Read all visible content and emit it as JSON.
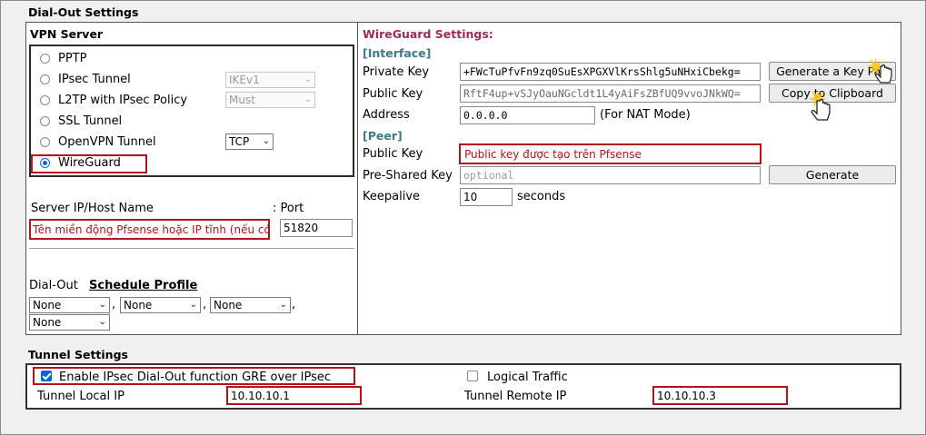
{
  "section_title": "Dial-Out Settings",
  "vpn_server": {
    "title": "VPN Server",
    "options": [
      {
        "label": "PPTP",
        "selected": false
      },
      {
        "label": "IPsec Tunnel",
        "selected": false
      },
      {
        "label": "L2TP with IPsec Policy",
        "selected": false
      },
      {
        "label": "SSL Tunnel",
        "selected": false
      },
      {
        "label": "OpenVPN Tunnel",
        "selected": false
      },
      {
        "label": "WireGuard",
        "selected": true
      }
    ],
    "ipsec_select": "IKEv1",
    "l2tp_select": "Must",
    "openvpn_select": "TCP"
  },
  "server": {
    "host_label": "Server IP/Host Name",
    "port_label": ": Port",
    "host_value": "Tên miền động Pfsense hoặc IP tĩnh (nếu có)",
    "port_value": "51820"
  },
  "dial_out": {
    "label": "Dial-Out",
    "schedule_label": "Schedule Profile",
    "profiles": [
      "None",
      "None",
      "None",
      "None"
    ],
    "separator": ","
  },
  "wireguard": {
    "title": "WireGuard Settings:",
    "interface_label": "[Interface]",
    "private_key_label": "Private Key",
    "private_key_value": "+FWcTuPfvFn9zq0SuEsXPGXVlKrsShlg5uNHxiCbekg=",
    "public_key_label": "Public Key",
    "public_key_value": "RftF4up+vSJyOauNGcldt1L4yAiFsZBfUQ9vvoJNkWQ=",
    "address_label": "Address",
    "address_value": "0.0.0.0",
    "address_note": "(For NAT Mode)",
    "generate_keypair_button": "Generate a Key Pair",
    "copy_button": "Copy to Clipboard",
    "peer_label": "[Peer]",
    "peer_public_key_label": "Public Key",
    "peer_public_key_value": "Public key được tạo trên Pfsense",
    "psk_label": "Pre-Shared Key",
    "psk_placeholder": "optional",
    "generate_button": "Generate",
    "keepalive_label": "Keepalive",
    "keepalive_value": "10",
    "keepalive_unit": "seconds"
  },
  "tunnel": {
    "title": "Tunnel Settings",
    "gre_label": "Enable IPsec Dial-Out function GRE over IPsec",
    "gre_checked": true,
    "logical_label": "Logical Traffic",
    "logical_checked": false,
    "local_ip_label": "Tunnel Local IP",
    "local_ip_value": "10.10.10.1",
    "remote_ip_label": "Tunnel Remote IP",
    "remote_ip_value": "10.10.10.3"
  },
  "colors": {
    "highlight": "#b3121f",
    "wireguard_title": "#9b2c5a",
    "bracket_label": "#3b7a86"
  }
}
